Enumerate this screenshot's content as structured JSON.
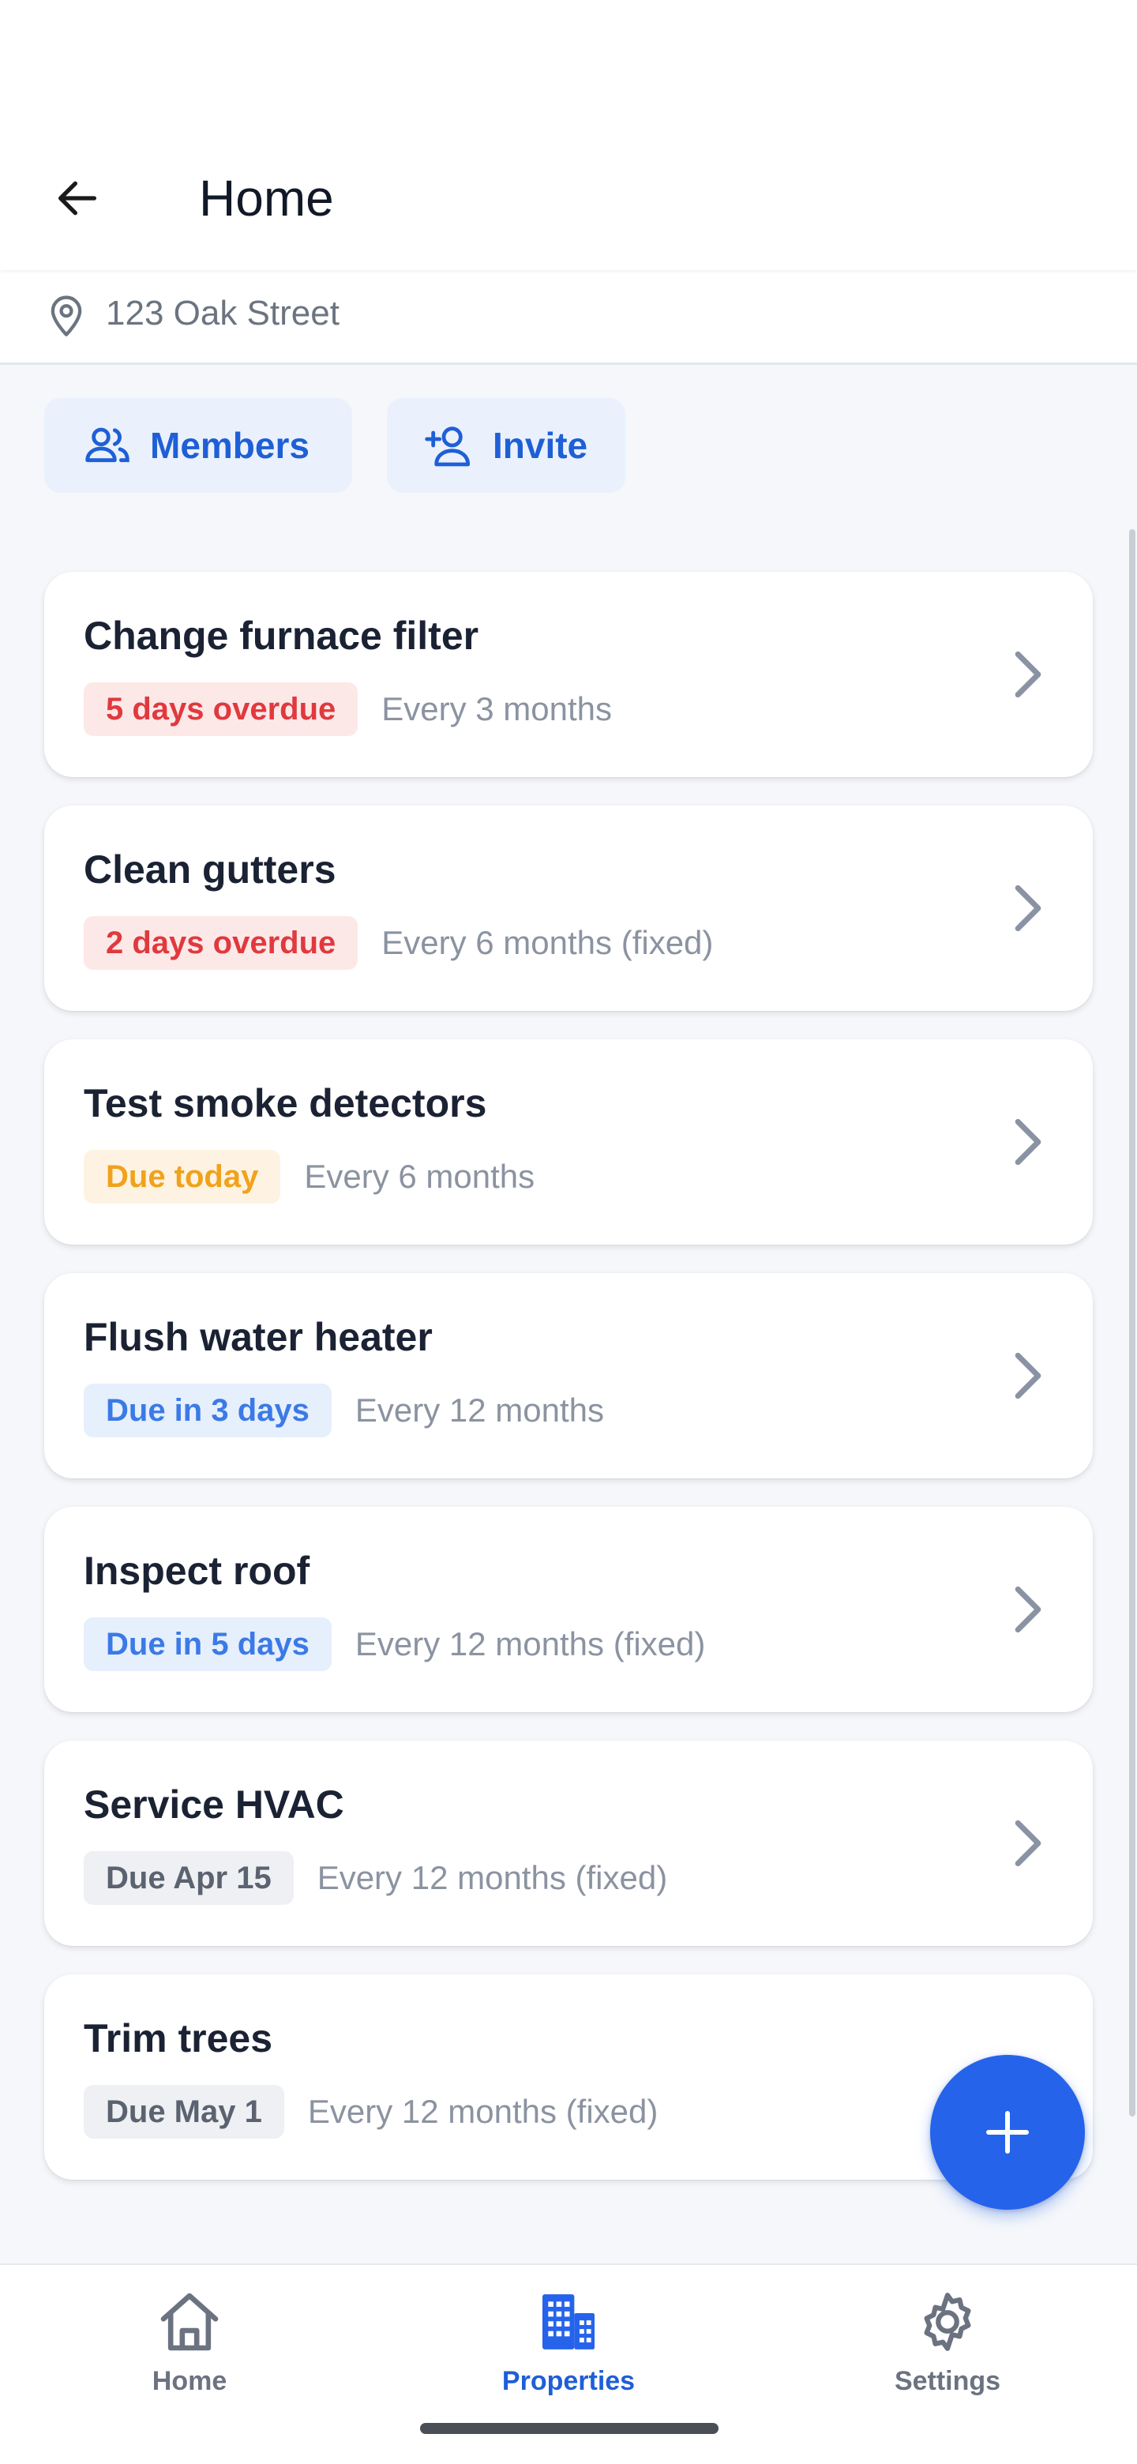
{
  "app_bar": {
    "title": "Home",
    "back_icon": "arrow-left-icon"
  },
  "property": {
    "address": "123 Oak Street",
    "icon": "map-pin-icon"
  },
  "actions": {
    "members": {
      "label": "Members",
      "icon": "users-icon"
    },
    "invite": {
      "label": "Invite",
      "icon": "user-plus-icon"
    }
  },
  "tasks": [
    {
      "title": "Change furnace filter",
      "status": "5 days overdue",
      "status_kind": "overdue",
      "frequency": "Every 3 months"
    },
    {
      "title": "Clean gutters",
      "status": "2 days overdue",
      "status_kind": "overdue",
      "frequency": "Every 6 months (fixed)"
    },
    {
      "title": "Test smoke detectors",
      "status": "Due today",
      "status_kind": "today",
      "frequency": "Every 6 months"
    },
    {
      "title": "Flush water heater",
      "status": "Due in 3 days",
      "status_kind": "soon",
      "frequency": "Every 12 months"
    },
    {
      "title": "Inspect roof",
      "status": "Due in 5 days",
      "status_kind": "soon",
      "frequency": "Every 12 months (fixed)"
    },
    {
      "title": "Service HVAC",
      "status": "Due Apr 15",
      "status_kind": "later",
      "frequency": "Every 12 months (fixed)"
    },
    {
      "title": "Trim trees",
      "status": "Due May 1",
      "status_kind": "later",
      "frequency": "Every 12 months (fixed)"
    }
  ],
  "fab": {
    "icon": "plus-icon"
  },
  "bottom_nav": {
    "items": [
      {
        "label": "Home",
        "icon": "house-icon",
        "active": false
      },
      {
        "label": "Properties",
        "icon": "building-icon",
        "active": true
      },
      {
        "label": "Settings",
        "icon": "gear-icon",
        "active": false
      }
    ]
  },
  "colors": {
    "accent": "#2563eb",
    "overdue": "#e0393e",
    "today": "#f0a21c",
    "soon": "#3b7ae6",
    "later": "#5b6370"
  }
}
